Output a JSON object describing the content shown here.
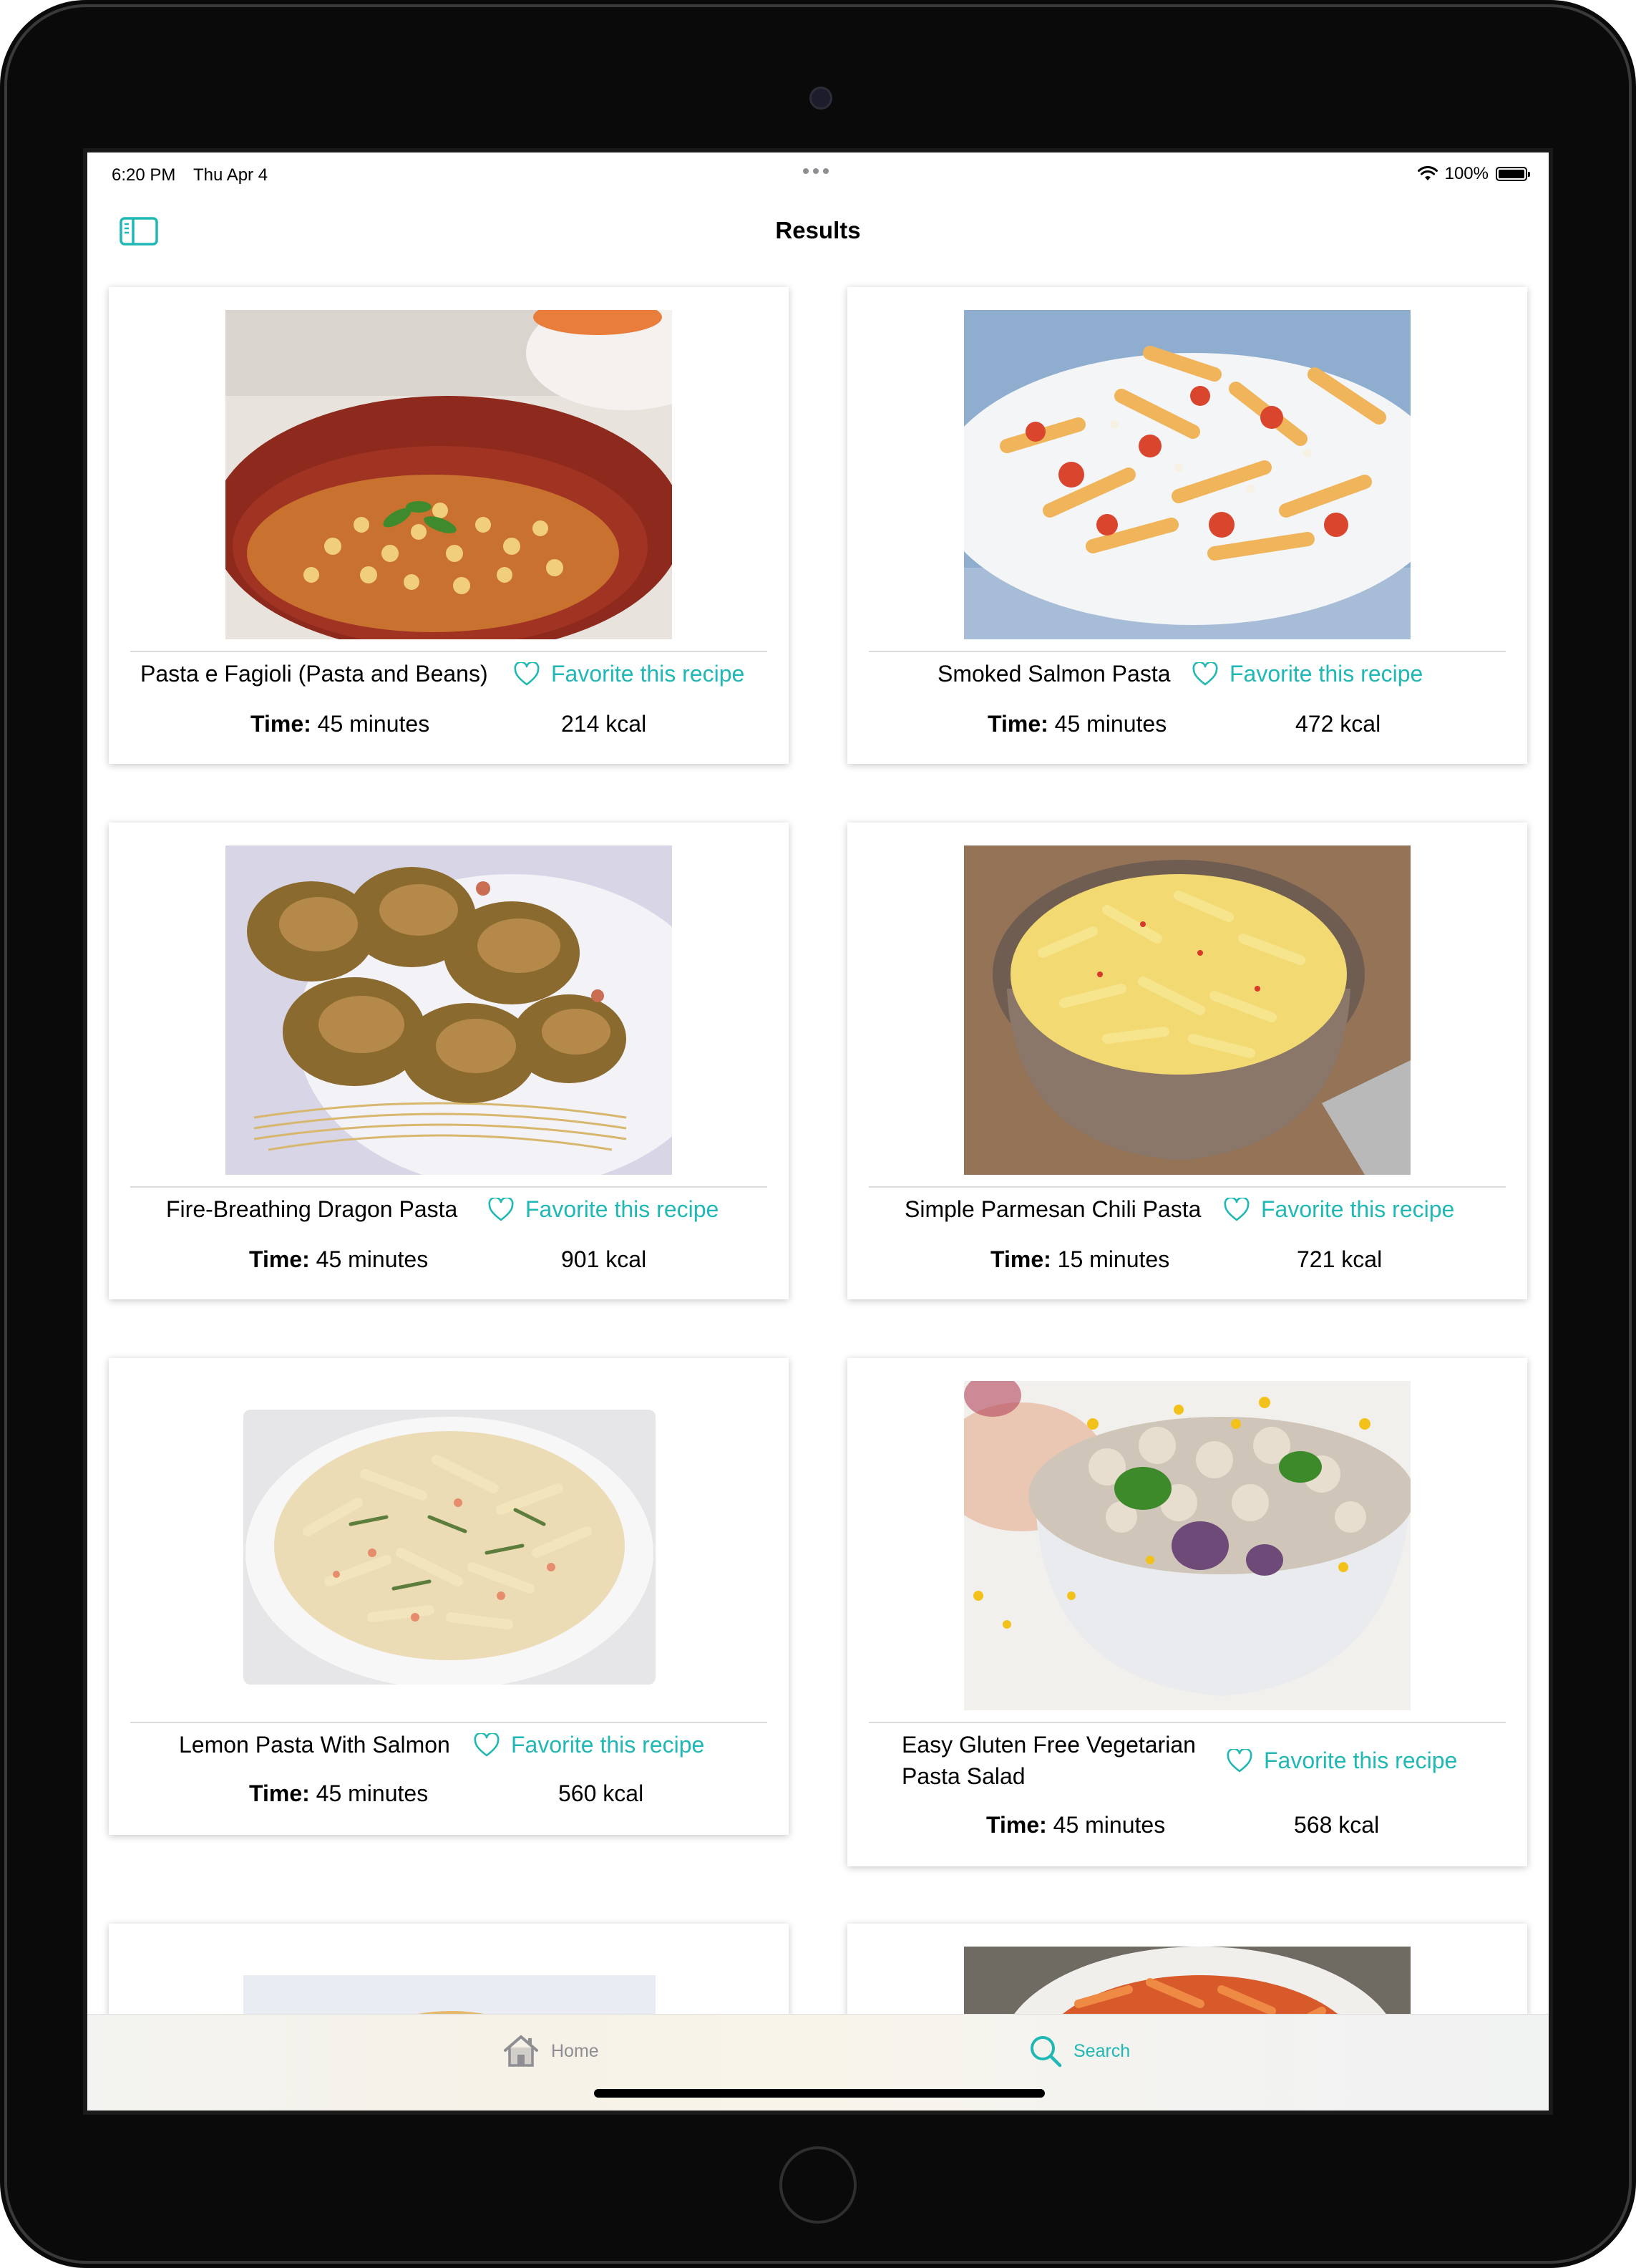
{
  "status_bar": {
    "time": "6:20 PM",
    "date": "Thu Apr 4",
    "battery": "100%"
  },
  "nav": {
    "title": "Results"
  },
  "favorite_label": "Favorite this recipe",
  "time_label": "Time:",
  "recipes": [
    {
      "title": "Pasta e Fagioli (Pasta and Beans)",
      "time": "45 minutes",
      "kcal": "214 kcal"
    },
    {
      "title": "Smoked Salmon Pasta",
      "time": "45 minutes",
      "kcal": "472 kcal"
    },
    {
      "title": "Fire-Breathing Dragon Pasta",
      "time": "45 minutes",
      "kcal": "901 kcal"
    },
    {
      "title": "Simple Parmesan Chili Pasta",
      "time": "15 minutes",
      "kcal": "721 kcal"
    },
    {
      "title": "Lemon Pasta With Salmon",
      "time": "45 minutes",
      "kcal": "560 kcal"
    },
    {
      "title": "Easy Gluten Free Vegetarian Pasta Salad",
      "time": "45 minutes",
      "kcal": "568 kcal"
    }
  ],
  "tabs": {
    "home": "Home",
    "search": "Search"
  },
  "colors": {
    "accent": "#1fb8b5",
    "inactive": "#8e8e93"
  }
}
